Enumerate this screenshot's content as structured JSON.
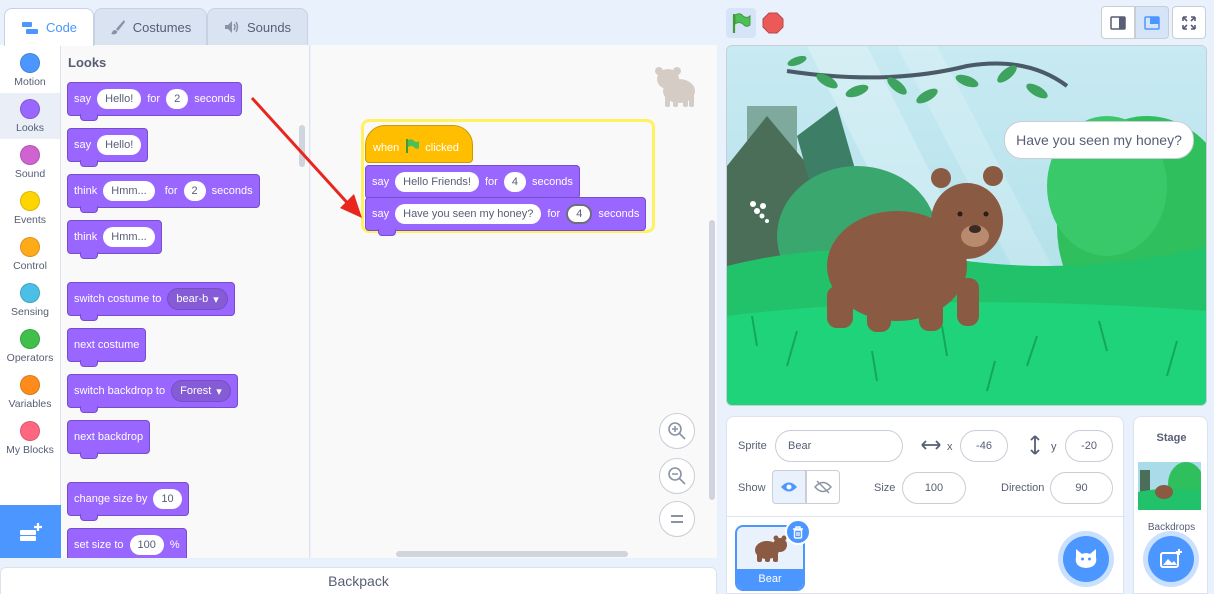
{
  "tabs": [
    {
      "label": "Code",
      "icon": "code-icon"
    },
    {
      "label": "Costumes",
      "icon": "brush-icon"
    },
    {
      "label": "Sounds",
      "icon": "speaker-icon"
    }
  ],
  "categories": [
    {
      "label": "Motion",
      "color": "#4c97ff"
    },
    {
      "label": "Looks",
      "color": "#9966ff"
    },
    {
      "label": "Sound",
      "color": "#cf63cf"
    },
    {
      "label": "Events",
      "color": "#ffd500"
    },
    {
      "label": "Control",
      "color": "#ffab19"
    },
    {
      "label": "Sensing",
      "color": "#4cbfe6"
    },
    {
      "label": "Operators",
      "color": "#40bf4a"
    },
    {
      "label": "Variables",
      "color": "#ff8c1a"
    },
    {
      "label": "My Blocks",
      "color": "#ff6680"
    }
  ],
  "palette": {
    "title": "Looks",
    "say_for": {
      "say": "say",
      "text": "Hello!",
      "for": "for",
      "secs": "2",
      "seconds": "seconds"
    },
    "say": {
      "say": "say",
      "text": "Hello!"
    },
    "think_for": {
      "think": "think",
      "text": "Hmm...",
      "for": "for",
      "secs": "2",
      "seconds": "seconds"
    },
    "think": {
      "think": "think",
      "text": "Hmm..."
    },
    "switch_costume": {
      "label": "switch costume to",
      "value": "bear-b"
    },
    "next_costume": "next costume",
    "switch_backdrop": {
      "label": "switch backdrop to",
      "value": "Forest"
    },
    "next_backdrop": "next backdrop",
    "change_size": {
      "label": "change size by",
      "value": "10"
    },
    "set_size": {
      "label": "set size to",
      "value": "100",
      "unit": "%"
    }
  },
  "script": {
    "hat": {
      "when": "when",
      "clicked": "clicked"
    },
    "say1": {
      "say": "say",
      "text": "Hello Friends!",
      "for": "for",
      "secs": "4",
      "seconds": "seconds"
    },
    "say2": {
      "say": "say",
      "text": "Have you seen my honey?",
      "for": "for",
      "secs": "4",
      "seconds": "seconds"
    }
  },
  "backpack": "Backpack",
  "stage": {
    "speech": "Have you seen my honey?"
  },
  "sprite_info": {
    "sprite_label": "Sprite",
    "sprite_name": "Bear",
    "x_label": "x",
    "x_value": "-46",
    "y_label": "y",
    "y_value": "-20",
    "show_label": "Show",
    "size_label": "Size",
    "size_value": "100",
    "direction_label": "Direction",
    "direction_value": "90"
  },
  "sprites": [
    {
      "name": "Bear"
    }
  ],
  "stage_panel": {
    "title": "Stage",
    "backdrops_label": "Backdrops"
  }
}
